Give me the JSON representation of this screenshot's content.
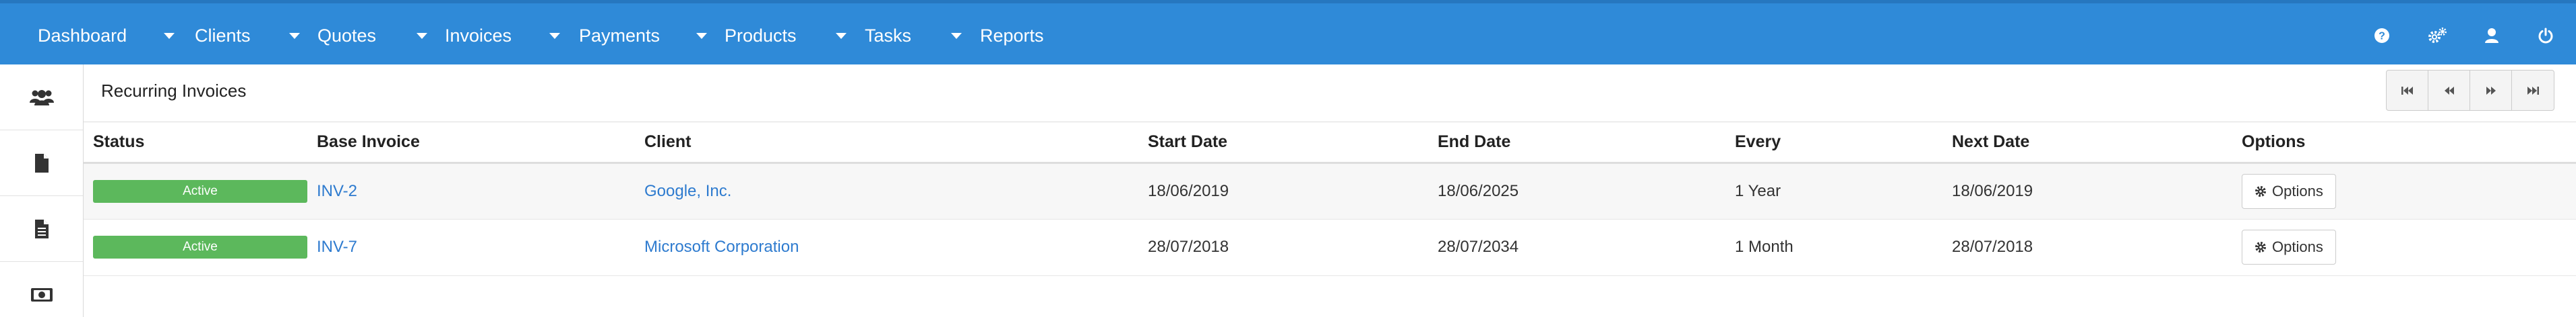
{
  "nav": {
    "items": [
      {
        "label": "Dashboard"
      },
      {
        "label": "Clients"
      },
      {
        "label": "Quotes"
      },
      {
        "label": "Invoices"
      },
      {
        "label": "Payments"
      },
      {
        "label": "Products"
      },
      {
        "label": "Tasks"
      },
      {
        "label": "Reports"
      }
    ],
    "right_icons": [
      "help-icon",
      "settings-icon",
      "user-icon",
      "power-icon"
    ],
    "color": "#2f8ad8"
  },
  "sidebar": {
    "icons": [
      "clients-icon",
      "invoices-icon",
      "quotes-icon",
      "payments-icon"
    ]
  },
  "page": {
    "title": "Recurring Invoices"
  },
  "pager": {
    "buttons": [
      "first-page-icon",
      "previous-page-icon",
      "next-page-icon",
      "last-page-icon"
    ]
  },
  "table": {
    "headers": {
      "status": "Status",
      "base_invoice": "Base Invoice",
      "client": "Client",
      "start_date": "Start Date",
      "end_date": "End Date",
      "every": "Every",
      "next_date": "Next Date",
      "options": "Options"
    },
    "rows": [
      {
        "status": "Active",
        "base_invoice": "INV-2",
        "client": "Google, Inc.",
        "start_date": "18/06/2019",
        "end_date": "18/06/2025",
        "every": "1 Year",
        "next_date": "18/06/2019",
        "options": "Options"
      },
      {
        "status": "Active",
        "base_invoice": "INV-7",
        "client": "Microsoft Corporation",
        "start_date": "28/07/2018",
        "end_date": "28/07/2034",
        "every": "1 Month",
        "next_date": "28/07/2018",
        "options": "Options"
      }
    ],
    "status_color": "#5cb85c",
    "link_color": "#2e7bcf"
  }
}
